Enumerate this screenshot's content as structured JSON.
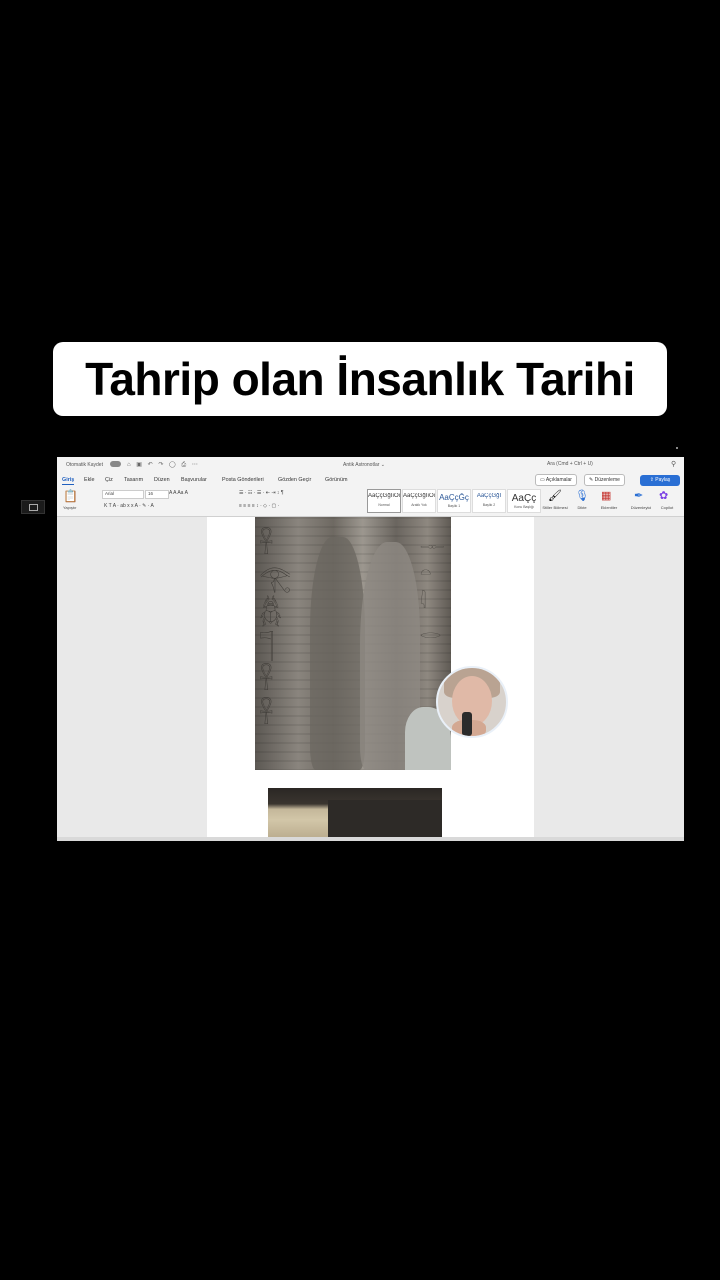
{
  "caption": {
    "text": "Tahrip olan İnsanlık Tarihi"
  },
  "word": {
    "titlebar": {
      "autosave_label": "Otomatik Kaydet",
      "doc_name": "Antik Astronotlar ⌄",
      "search_placeholder": "Ara (Cmd + Ctrl + U)"
    },
    "menu": [
      "Giriş",
      "Ekle",
      "Çiz",
      "Tasarım",
      "Düzen",
      "Başvurular",
      "Posta Gönderileri",
      "Gözden Geçir",
      "Görünüm"
    ],
    "right_buttons": {
      "comments": "Açıklamalar",
      "editing": "Düzenleme",
      "share": "Paylaş"
    },
    "ribbon": {
      "paste": "Yapıştır",
      "font_name": "Arial",
      "font_size": "16",
      "styles": [
        {
          "sample": "AaÇçĞğİıOo",
          "label": "Normal"
        },
        {
          "sample": "AaÇçĞğİıOo",
          "label": "Aralık Yok"
        },
        {
          "sample": "AaÇçĞç",
          "label": "Başlık 1"
        },
        {
          "sample": "AaÇçĞğİ",
          "label": "Başlık 2"
        },
        {
          "sample": "AaÇç",
          "label": "Konu Başlığı"
        }
      ],
      "tools": {
        "styles_pane": "Stiller Bölmesi",
        "dictate": "Dikte",
        "addins": "Eklentiler",
        "editor": "Düzenleyici",
        "copilot": "Copilot"
      }
    }
  }
}
